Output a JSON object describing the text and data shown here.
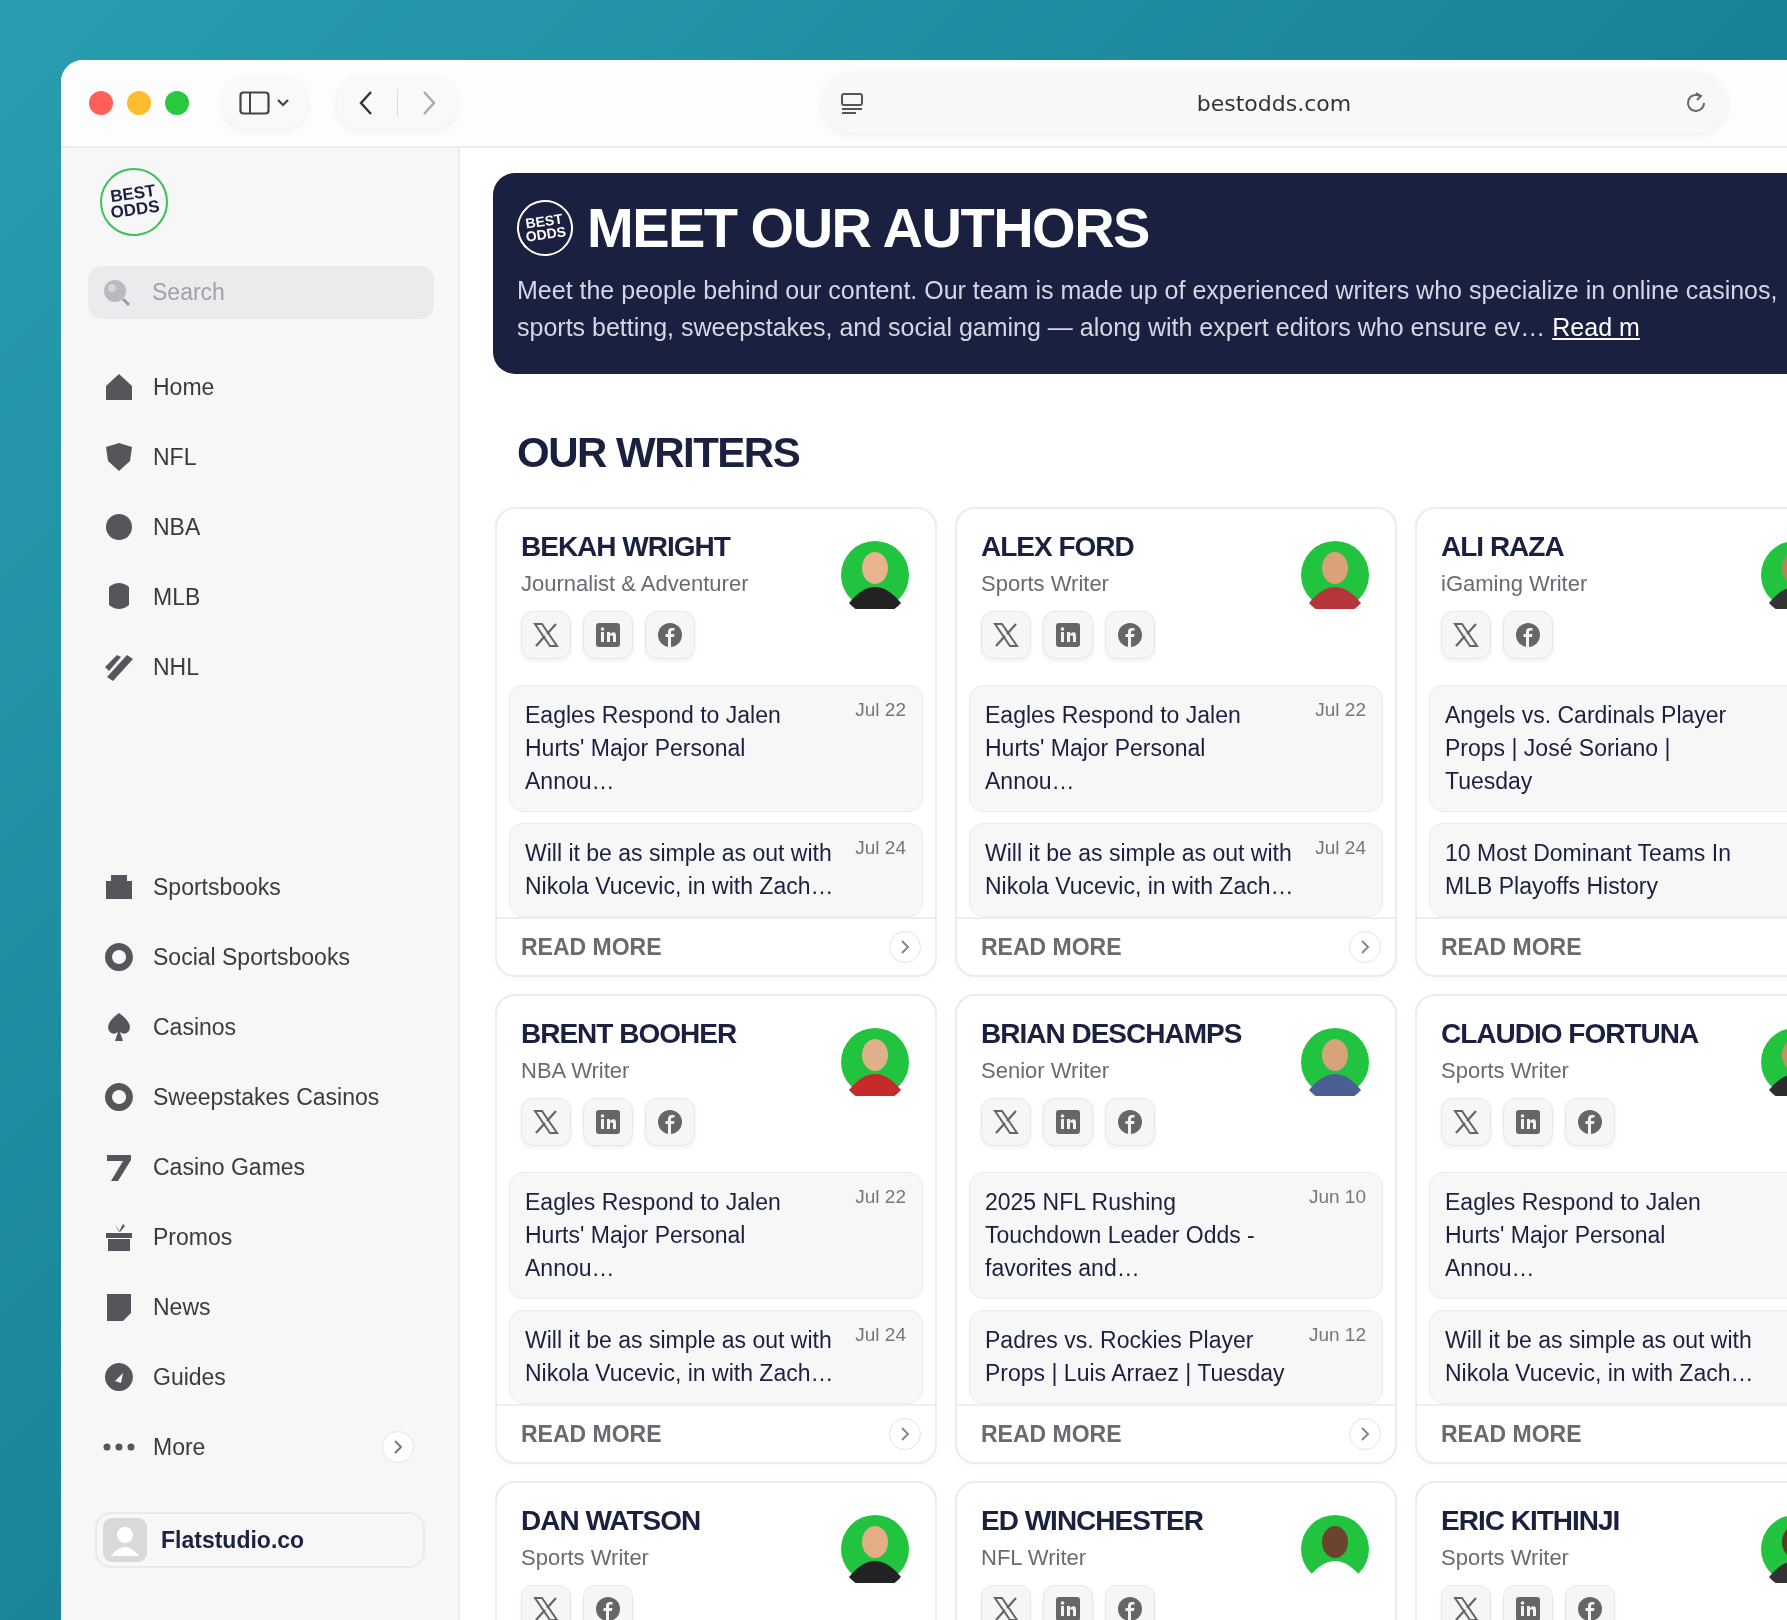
{
  "browser": {
    "url": "bestodds.com"
  },
  "sidebar": {
    "logo": {
      "line1": "BEST",
      "line2": "ODDS"
    },
    "search": {
      "placeholder": "Search"
    },
    "nav_primary": [
      {
        "label": "Home"
      },
      {
        "label": "NFL"
      },
      {
        "label": "NBA"
      },
      {
        "label": "MLB"
      },
      {
        "label": "NHL"
      }
    ],
    "nav_secondary": [
      {
        "label": "Sportsbooks"
      },
      {
        "label": "Social Sportsbooks"
      },
      {
        "label": "Casinos"
      },
      {
        "label": "Sweepstakes Casinos"
      },
      {
        "label": "Casino Games"
      },
      {
        "label": "Promos"
      },
      {
        "label": "News"
      },
      {
        "label": "Guides"
      }
    ],
    "more": {
      "label": "More"
    },
    "user": {
      "name": "Flatstudio.co"
    }
  },
  "banner": {
    "logo": {
      "line1": "BEST",
      "line2": "ODDS"
    },
    "title": "MEET OUR AUTHORS",
    "description": "Meet the people behind our content. Our team is made up of experienced writers who specialize in online casinos, sports betting, sweepstakes, and social gaming — along with expert editors who ensure ev…",
    "link": "Read m"
  },
  "section_title": "OUR WRITERS",
  "writers": [
    {
      "name": "BEKAH WRIGHT",
      "role": "Journalist & Adventurer",
      "socials": [
        {
          "kind": "x"
        },
        {
          "kind": "linkedin"
        },
        {
          "kind": "facebook"
        }
      ],
      "articles": [
        {
          "title": "Eagles Respond to Jalen Hurts' Major Personal Annou…",
          "date": "Jul 22"
        },
        {
          "title": "Will it be as simple as out with Nikola Vucevic, in with Zach…",
          "date": "Jul 24"
        }
      ],
      "read_more": "READ MORE",
      "next_button": true
    },
    {
      "name": "ALEX FORD",
      "role": "Sports Writer",
      "socials": [
        {
          "kind": "x"
        },
        {
          "kind": "linkedin"
        },
        {
          "kind": "facebook"
        }
      ],
      "articles": [
        {
          "title": "Eagles Respond to Jalen Hurts' Major Personal Annou…",
          "date": "Jul 22"
        },
        {
          "title": "Will it be as simple as out with Nikola Vucevic, in with Zach…",
          "date": "Jul 24"
        }
      ],
      "read_more": "READ MORE",
      "next_button": true
    },
    {
      "name": "ALI RAZA",
      "role": "iGaming Writer",
      "socials": [
        {
          "kind": "x"
        },
        {
          "kind": "facebook"
        }
      ],
      "articles": [
        {
          "title": "Angels vs. Cardinals Player Props | José Soriano | Tuesday"
        },
        {
          "title": "10 Most Dominant Teams In MLB Playoffs History"
        }
      ],
      "read_more": "READ MORE",
      "next_button": false
    },
    {
      "name": "BRENT BOOHER",
      "role": "NBA Writer",
      "socials": [
        {
          "kind": "x"
        },
        {
          "kind": "linkedin"
        },
        {
          "kind": "facebook"
        }
      ],
      "articles": [
        {
          "title": "Eagles Respond to Jalen Hurts' Major Personal Annou…",
          "date": "Jul 22"
        },
        {
          "title": "Will it be as simple as out with Nikola Vucevic, in with Zach…",
          "date": "Jul 24"
        }
      ],
      "read_more": "READ MORE",
      "next_button": true
    },
    {
      "name": "BRIAN DESCHAMPS",
      "role": "Senior Writer",
      "socials": [
        {
          "kind": "x"
        },
        {
          "kind": "linkedin"
        },
        {
          "kind": "facebook"
        }
      ],
      "articles": [
        {
          "title": "2025 NFL Rushing Touchdown Leader Odds - favorites and…",
          "date": "Jun 10"
        },
        {
          "title": "Padres vs. Rockies Player Props | Luis Arraez | Tuesday",
          "date": "Jun 12"
        }
      ],
      "read_more": "READ MORE",
      "next_button": true
    },
    {
      "name": "CLAUDIO FORTUNA",
      "role": "Sports Writer",
      "socials": [
        {
          "kind": "x"
        },
        {
          "kind": "linkedin"
        },
        {
          "kind": "facebook"
        }
      ],
      "articles": [
        {
          "title": "Eagles Respond to Jalen Hurts' Major Personal Annou…"
        },
        {
          "title": "Will it be as simple as out with Nikola Vucevic, in with Zach…"
        }
      ],
      "read_more": "READ MORE",
      "next_button": false
    },
    {
      "name": "DAN WATSON",
      "role": "Sports Writer",
      "socials": [
        {
          "kind": "x"
        },
        {
          "kind": "facebook"
        }
      ]
    },
    {
      "name": "ED WINCHESTER",
      "role": "NFL Writer",
      "socials": [
        {
          "kind": "x"
        },
        {
          "kind": "linkedin"
        },
        {
          "kind": "facebook"
        }
      ]
    },
    {
      "name": "ERIC KITHINJI",
      "role": "Sports Writer",
      "socials": [
        {
          "kind": "x"
        },
        {
          "kind": "linkedin"
        },
        {
          "kind": "facebook"
        }
      ]
    }
  ]
}
